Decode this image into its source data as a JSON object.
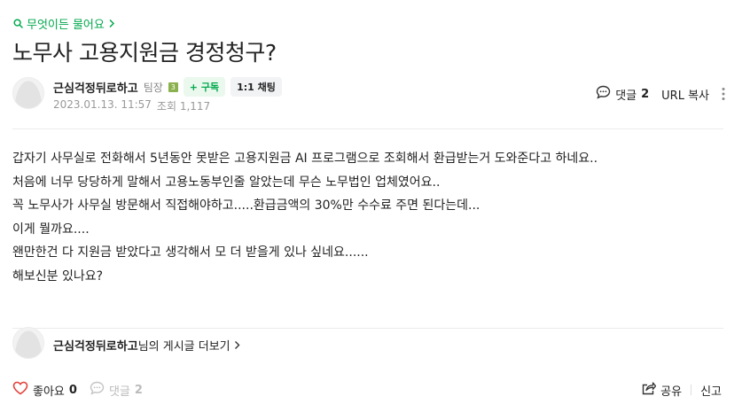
{
  "board": {
    "label": "무엇이든 물어요",
    "icon": "search-icon",
    "arrow_icon": "chevron-right-icon"
  },
  "post": {
    "title": "노무사 고용지원금 경정청구?",
    "author": {
      "nickname": "근심걱정뒤로하고",
      "grade": "팀장",
      "grade_badge": "3",
      "follow_label": "+ 구독",
      "chat_label": "1:1 채팅"
    },
    "date": "2023.01.13. 11:57",
    "views_label": "조회 1,117",
    "content": [
      "갑자기 사무실로 전화해서 5년동안 못받은 고용지원금 AI 프로그램으로 조회해서 환급받는거 도와준다고 하네요..",
      "처음에 너무 당당하게 말해서 고용노동부인줄 알았는데 무슨 노무법인 업체였어요..",
      "꼭 노무사가 사무실 방문해서 직접해야하고.....환급금액의 30%만 수수료 주면 된다는데...",
      "이게 뭘까요....",
      "왠만한건 다 지원금 받았다고 생각해서 모 더 받을게 있나 싶네요......",
      "해보신분 있나요?"
    ]
  },
  "top_actions": {
    "comment_label": "댓글",
    "comment_count": "2",
    "url_copy_label": "URL 복사"
  },
  "more_posts": {
    "nickname": "근심걱정뒤로하고",
    "suffix": "님의 게시글 더보기"
  },
  "bottom_actions": {
    "like_label": "좋아요",
    "like_count": "0",
    "comment_label": "댓글",
    "comment_count": "2",
    "share_label": "공유",
    "report_label": "신고"
  },
  "colors": {
    "accent": "#03a94d",
    "like_heart": "#e2423c",
    "grade_badge": "#8bb14e"
  }
}
